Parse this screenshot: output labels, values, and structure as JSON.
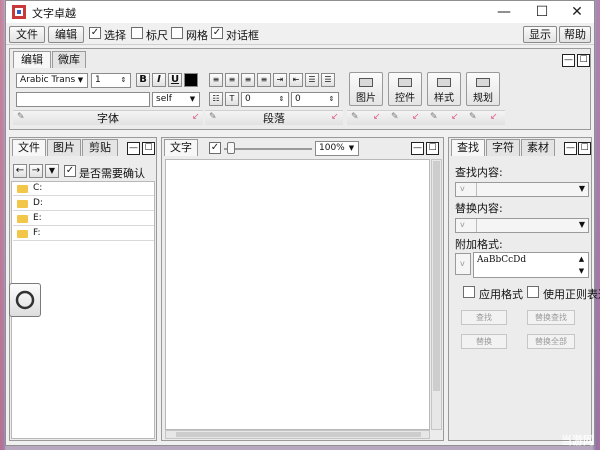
{
  "window": {
    "title": "文字卓越",
    "controls": {
      "minimize": "—",
      "maximize": "☐",
      "close": "✕"
    }
  },
  "menubar": {
    "file": "文件",
    "edit": "编辑",
    "checks": [
      {
        "label": "选择",
        "checked": true
      },
      {
        "label": "标尺",
        "checked": false
      },
      {
        "label": "网格",
        "checked": false
      },
      {
        "label": "对话框",
        "checked": true
      }
    ],
    "show": "显示",
    "help": "帮助"
  },
  "ribbon": {
    "tabs": [
      "编辑",
      "微库"
    ],
    "font": {
      "name": "Arabic Trans",
      "size": "1",
      "bold": "B",
      "italic": "I",
      "underline": "U",
      "style": "self",
      "label": "字体"
    },
    "paragraph": {
      "indent1": "0",
      "indent2": "0",
      "label": "段落"
    },
    "buttons": [
      "图片",
      "控件",
      "样式",
      "规划"
    ]
  },
  "left_panel": {
    "tabs": [
      "文件",
      "图片",
      "剪贴"
    ],
    "confirm_label": "是否需要确认",
    "confirm_checked": true,
    "drives": [
      "C:",
      "D:",
      "E:",
      "F:"
    ]
  },
  "center_panel": {
    "tab": "文字",
    "zoom": "100%"
  },
  "right_panel": {
    "tabs": [
      "查找",
      "字符",
      "素材"
    ],
    "find_label": "查找内容:",
    "replace_label": "替换内容:",
    "format_label": "附加格式:",
    "format_preview": "AaBbCcDd",
    "opt_format": "应用格式",
    "opt_regex": "使用正则表达",
    "btn_find": "查找",
    "btn_replace_find": "替换查找",
    "btn_replace": "替换",
    "btn_replace_all": "替换全部",
    "combo_v": "v"
  },
  "watermark": "当游网",
  "colors": {
    "accent_pink": "#e05a89",
    "folder": "#f2c649",
    "window_bg": "#f0f0f0"
  }
}
